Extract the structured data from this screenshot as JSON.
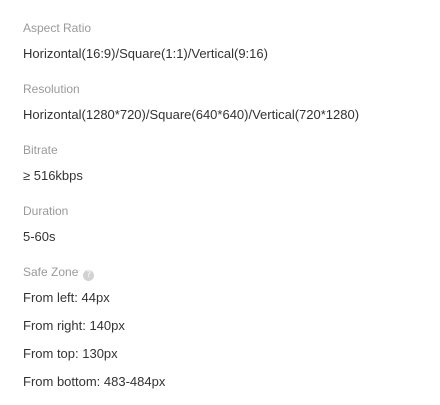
{
  "aspect_ratio": {
    "label": "Aspect Ratio",
    "value": "Horizontal(16:9)/Square(1:1)/Vertical(9:16)"
  },
  "resolution": {
    "label": "Resolution",
    "value": "Horizontal(1280*720)/Square(640*640)/Vertical(720*1280)"
  },
  "bitrate": {
    "label": "Bitrate",
    "value": "≥ 516kbps"
  },
  "duration": {
    "label": "Duration",
    "value": "5-60s"
  },
  "safe_zone": {
    "label": "Safe Zone",
    "help_icon": "question-circle-icon",
    "help_glyph": "?",
    "items": [
      "From left: 44px",
      "From right: 140px",
      "From top: 130px",
      "From bottom: 483-484px"
    ]
  }
}
